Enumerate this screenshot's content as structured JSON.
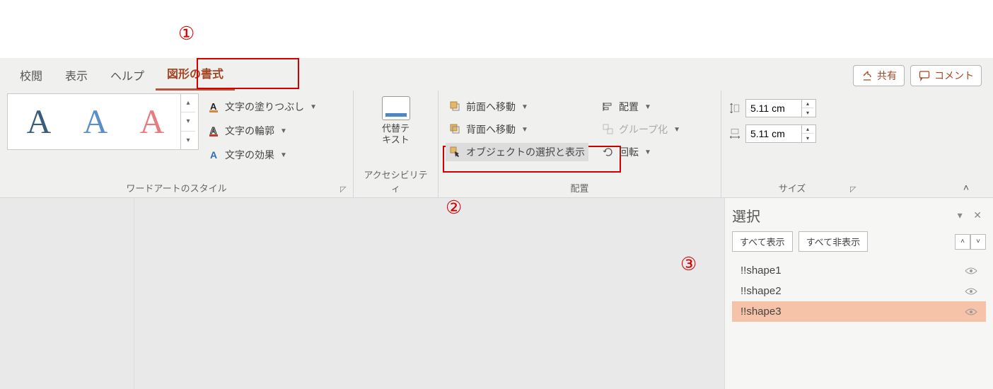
{
  "annotations": {
    "n1": "①",
    "n2": "②",
    "n3": "③"
  },
  "tabs": {
    "review": "校閲",
    "view": "表示",
    "help": "ヘルプ",
    "shapeformat": "図形の書式"
  },
  "header_buttons": {
    "share": "共有",
    "comment": "コメント"
  },
  "ribbon": {
    "wordart_group": "ワードアートのスタイル",
    "wa_sample": "A",
    "textfill": "文字の塗りつぶし",
    "textoutline": "文字の輪郭",
    "texteffects": "文字の効果",
    "accessibility_group": "アクセシビリティ",
    "alttext_line1": "代替テ",
    "alttext_line2": "キスト",
    "arrange_group": "配置",
    "bringforward": "前面へ移動",
    "sendbackward": "背面へ移動",
    "selectionpane": "オブジェクトの選択と表示",
    "align": "配置",
    "group": "グループ化",
    "rotate": "回転",
    "size_group": "サイズ",
    "height": "5.11 cm",
    "width": "5.11 cm"
  },
  "pane": {
    "title": "選択",
    "show_all": "すべて表示",
    "hide_all": "すべて非表示",
    "items": [
      {
        "name": "!!shape1"
      },
      {
        "name": "!!shape2"
      },
      {
        "name": "!!shape3"
      }
    ]
  }
}
